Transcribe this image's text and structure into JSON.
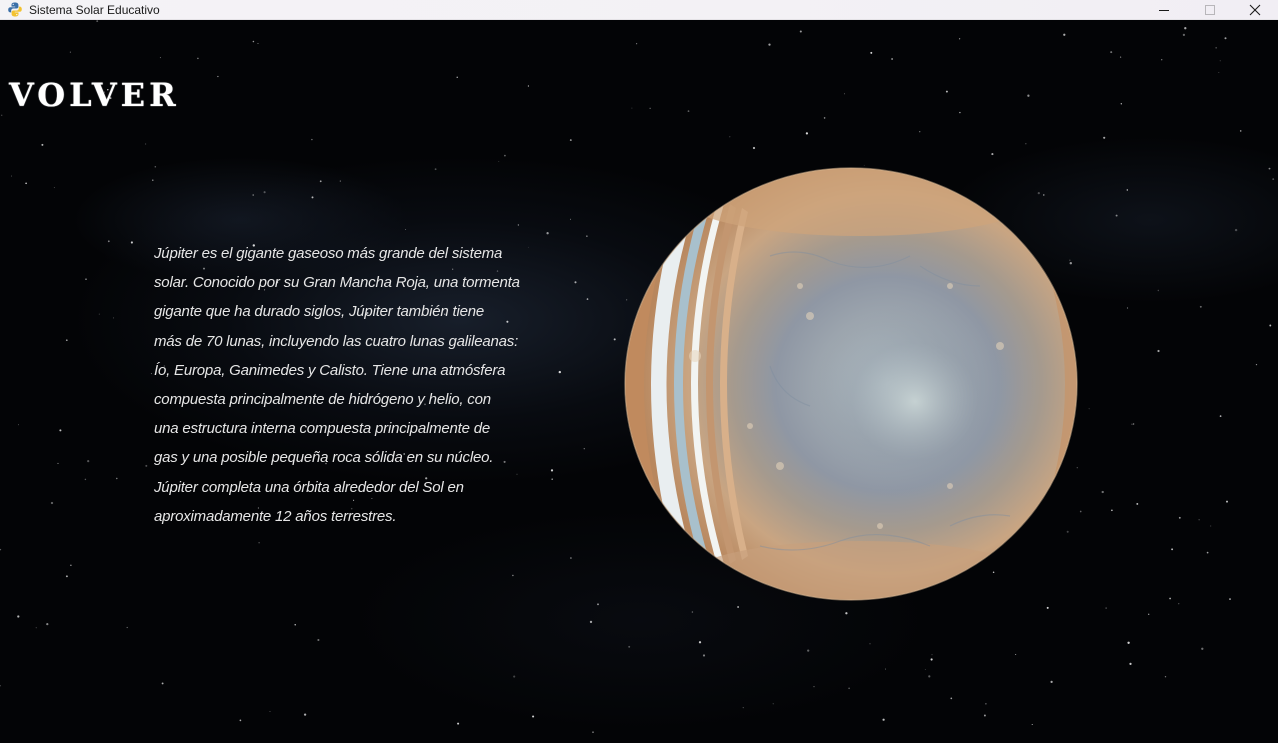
{
  "window": {
    "title": "Sistema Solar Educativo",
    "icon": "python-icon",
    "controls": {
      "minimize": "minimize-icon",
      "maximize": "maximize-icon",
      "close": "close-icon"
    }
  },
  "scene": {
    "back_button_label": "VOLVER",
    "description": "Júpiter es el gigante gaseoso más grande del sistema\nsolar. Conocido por su Gran Mancha Roja, una tormenta\ngigante que ha durado siglos, Júpiter también tiene\nmás de 70 lunas, incluyendo las cuatro lunas galileanas:\nÍo, Europa, Ganimedes y Calisto. Tiene una atmósfera\ncompuesta principalmente de hidrógeno y helio, con\nuna estructura interna compuesta principalmente de\ngas y una posible pequeña roca sólida en su núcleo.\nJúpiter completa una órbita alrededor del Sol en\naproximadamente 12 años terrestres.",
    "planet": "jupiter"
  },
  "colors": {
    "background": "#030406",
    "text": "#e6e6e6",
    "titlebar": "#f3f1f5"
  }
}
